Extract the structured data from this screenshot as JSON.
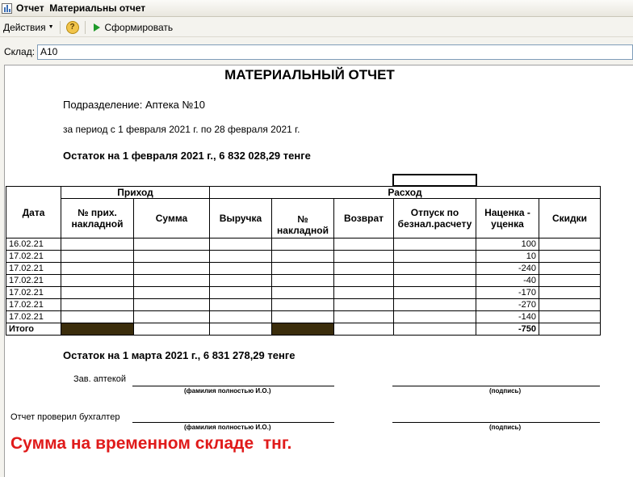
{
  "window": {
    "title": "Отчет  Материальны отчет"
  },
  "toolbar": {
    "actions_label": "Действия",
    "help_label": "?",
    "generate_label": "Сформировать"
  },
  "filter": {
    "warehouse_label": "Склад:",
    "warehouse_value": "А10"
  },
  "report": {
    "title": "МАТЕРИАЛЬНЫЙ ОТЧЕТ",
    "department": "Подразделение: Аптека №10",
    "period": "за период с 1 февраля 2021 г. по 28 февраля 2021 г.",
    "opening_balance": "Остаток на 1 февраля 2021 г., 6 832 028,29 тенге",
    "table": {
      "col_date": "Дата",
      "group_income": "Приход",
      "group_expense": "Расход",
      "col_invoice_no": "№ прих. накладной",
      "col_sum": "Сумма",
      "col_revenue": "Выручка",
      "col_waybill_no": "№ накладной",
      "col_return": "Возврат",
      "col_noncash": "Отпуск по безнал.расчету",
      "col_markup": "Наценка - уценка",
      "col_discounts": "Скидки",
      "rows": [
        {
          "date": "16.02.21",
          "markup": "100"
        },
        {
          "date": "17.02.21",
          "markup": "10"
        },
        {
          "date": "17.02.21",
          "markup": "-240"
        },
        {
          "date": "17.02.21",
          "markup": "-40"
        },
        {
          "date": "17.02.21",
          "markup": "-170"
        },
        {
          "date": "17.02.21",
          "markup": "-270"
        },
        {
          "date": "17.02.21",
          "markup": "-140"
        }
      ],
      "total_label": "Итого",
      "total_markup": "-750"
    },
    "closing_balance": "Остаток на 1 марта 2021 г., 6 831 278,29 тенге",
    "head_label": "Зав. аптекой",
    "accountant_label": "Отчет проверил бухгалтер",
    "fullname_caption": "(фамилия полностью И.О.)",
    "signature_caption": "(подпись)",
    "note": "Сумма на временном складе  тнг."
  },
  "colors": {
    "note": "#e01a1a",
    "shaded_cell": "#3b2d0c"
  }
}
